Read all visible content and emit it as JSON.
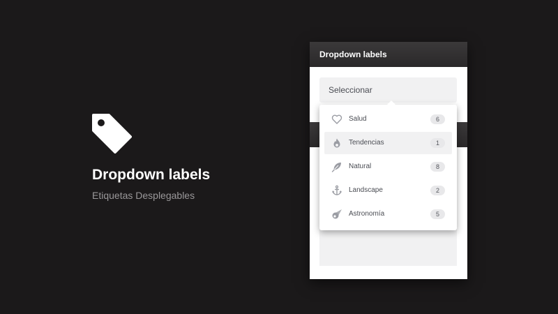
{
  "hero": {
    "title": "Dropdown labels",
    "subtitle": "Etiquetas Desplegables",
    "icon": "tag-icon"
  },
  "card": {
    "header_title": "Dropdown labels",
    "select_value": "Seleccionar"
  },
  "dropdown": {
    "items": [
      {
        "label": "Salud",
        "count": "6",
        "icon": "heart-icon",
        "active": false
      },
      {
        "label": "Tendencias",
        "count": "1",
        "icon": "flame-icon",
        "active": true
      },
      {
        "label": "Natural",
        "count": "8",
        "icon": "feather-icon",
        "active": false
      },
      {
        "label": "Landscape",
        "count": "2",
        "icon": "anchor-icon",
        "active": false
      },
      {
        "label": "Astronomía",
        "count": "5",
        "icon": "comet-icon",
        "active": false
      }
    ]
  },
  "colors": {
    "background": "#1b191a",
    "header": "#2f2d2e",
    "icon_grey": "#9a9ca3",
    "badge_bg": "#e8e8ea"
  }
}
